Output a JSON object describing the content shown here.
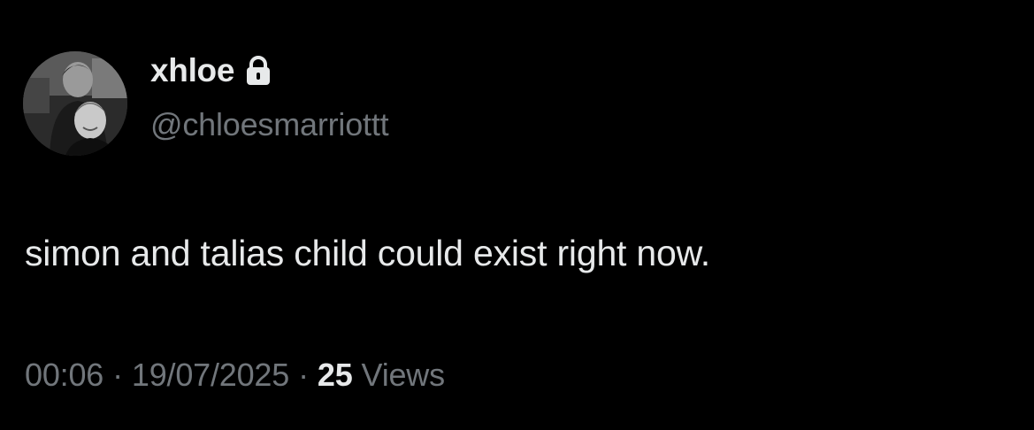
{
  "tweet": {
    "display_name": "xhloe",
    "handle": "@chloesmarriottt",
    "text": "simon and talias child could exist right now.",
    "time": "00:06",
    "date": "19/07/2025",
    "separator": "·",
    "views_count": "25",
    "views_label": "Views",
    "protected_icon": "lock-icon"
  },
  "colors": {
    "background": "#000000",
    "primary_text": "#e7e9ea",
    "secondary_text": "#71767b"
  }
}
